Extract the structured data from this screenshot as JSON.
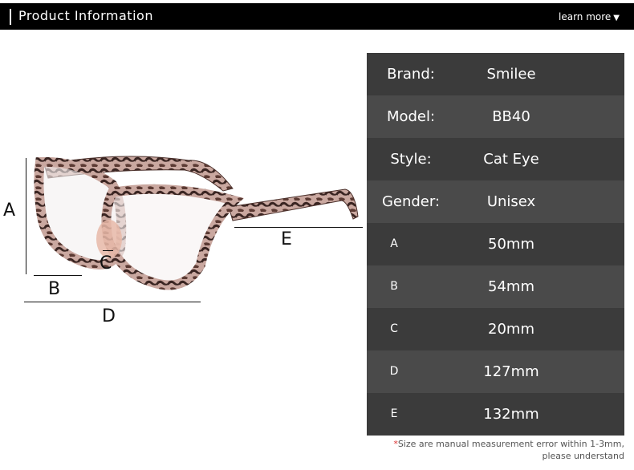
{
  "header": {
    "title": "Product Information",
    "more_label": "learn more",
    "more_icon": "triangle-down"
  },
  "figure": {
    "labels": {
      "A": "A",
      "B": "B",
      "C": "C",
      "D": "D",
      "E": "E"
    }
  },
  "table": [
    {
      "key": "Brand:",
      "value": "Smilee"
    },
    {
      "key": "Model:",
      "value": "BB40"
    },
    {
      "key": "Style:",
      "value": "Cat Eye"
    },
    {
      "key": "Gender:",
      "value": "Unisex"
    },
    {
      "key": "A",
      "value": "50mm"
    },
    {
      "key": "B",
      "value": "54mm"
    },
    {
      "key": "C",
      "value": "20mm"
    },
    {
      "key": "D",
      "value": "127mm"
    },
    {
      "key": "E",
      "value": "132mm"
    }
  ],
  "note": {
    "star": "*",
    "line1": "Size are manual measurement error within 1-3mm,",
    "line2": "please understand"
  },
  "colors": {
    "header_bg": "#000000",
    "row_dark": "#3b3b3b",
    "row_light": "#4a4a4a",
    "note_star": "#dd3333"
  }
}
